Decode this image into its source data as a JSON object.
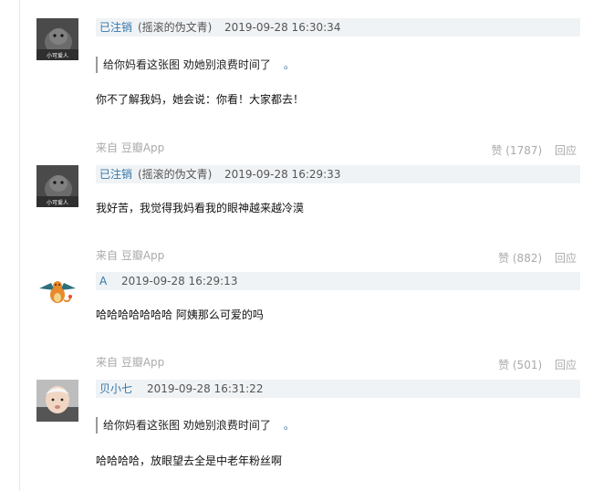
{
  "comments": [
    {
      "user": "已注销",
      "handle": "(摇滚的伪文青)",
      "time": "2019-09-28 16:30:34",
      "quote": "给你妈看这张图 劝她别浪费时间了",
      "quote_mark": "。",
      "text": "你不了解我妈，她会说：你看！大家都去！",
      "source": "来自 豆瓣App",
      "like": "赞 (1787)",
      "reply": "回应",
      "avatar_caption": "小可爱人"
    },
    {
      "user": "已注销",
      "handle": "(摇滚的伪文青)",
      "time": "2019-09-28 16:29:33",
      "text": "我好苦，我觉得我妈看我的眼神越来越冷漠",
      "source": "来自 豆瓣App",
      "like": "赞 (882)",
      "reply": "回应",
      "avatar_caption": "小可爱人"
    },
    {
      "user": "A",
      "time": "2019-09-28 16:29:13",
      "text": "哈哈哈哈哈哈哈 阿姨那么可爱的吗",
      "source": "来自 豆瓣App",
      "like": "赞 (501)",
      "reply": "回应"
    },
    {
      "user": "贝小七",
      "time": "2019-09-28 16:31:22",
      "quote": "给你妈看这张图 劝她别浪费时间了",
      "quote_mark": "。",
      "text": "哈哈哈哈，放眼望去全是中老年粉丝啊"
    }
  ]
}
